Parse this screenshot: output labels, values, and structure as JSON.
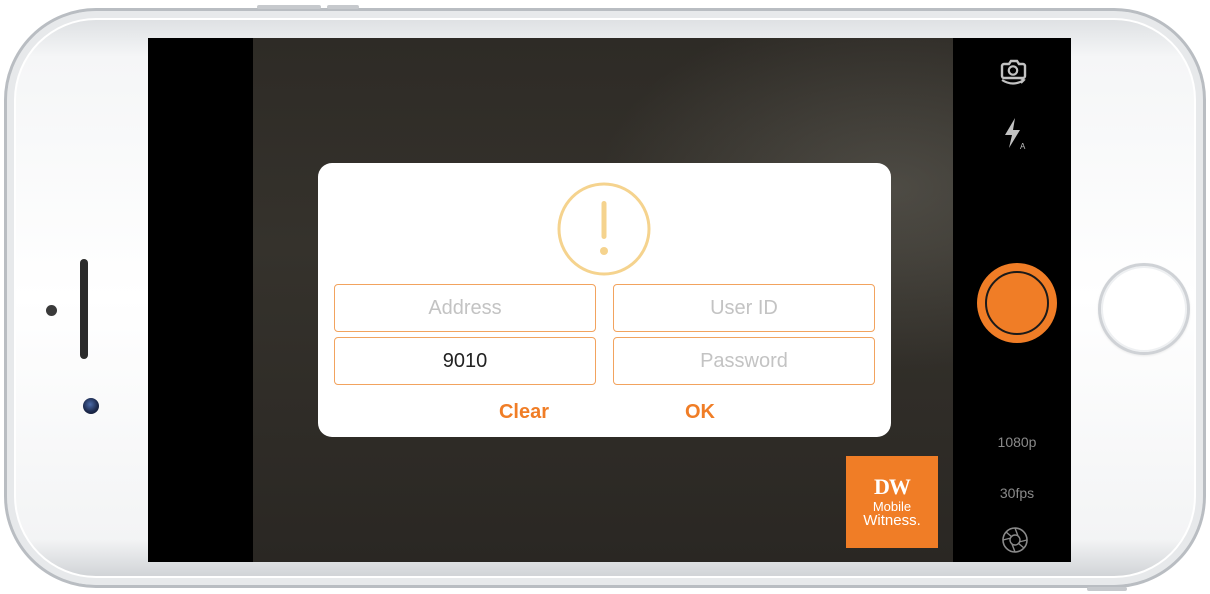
{
  "dialog": {
    "address_placeholder": "Address",
    "userid_placeholder": "User ID",
    "port_value": "9010",
    "password_placeholder": "Password",
    "clear_label": "Clear",
    "ok_label": "OK",
    "alert_icon": "exclamation-circle-icon"
  },
  "camera": {
    "resolution": "1080p",
    "framerate": "30fps",
    "flip_icon": "camera-flip-icon",
    "flash_icon": "flash-auto-icon",
    "settings_icon": "aperture-settings-icon"
  },
  "logo": {
    "brand": "DW",
    "line1": "Mobile",
    "line2": "Witness."
  },
  "colors": {
    "accent": "#f07d26",
    "alert_icon": "#f5d38e",
    "field_border": "#f2a35e"
  }
}
